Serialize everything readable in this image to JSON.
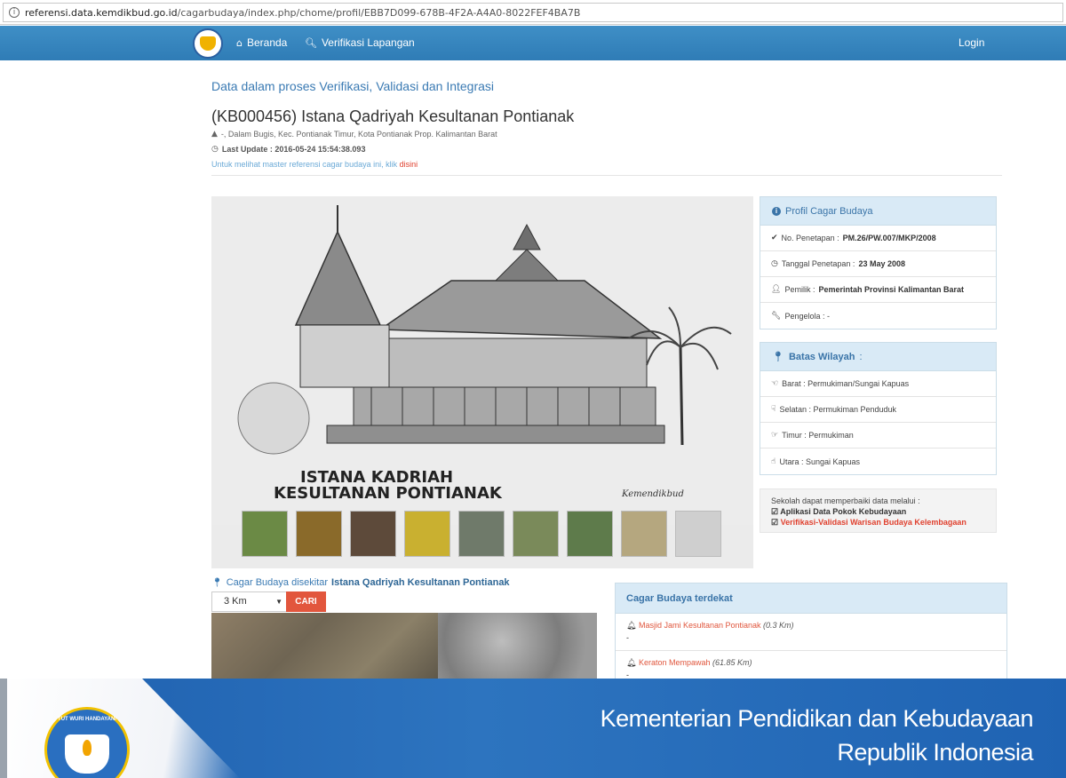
{
  "browser": {
    "url_host": "referensi.data.kemdikbud.go.id",
    "url_path": "/cagarbudaya/index.php/chome/profil/EBB7D099-678B-4F2A-A4A0-8022FEF4BA7B"
  },
  "navbar": {
    "home_label": "Beranda",
    "verif_label": "Verifikasi Lapangan",
    "login_label": "Login",
    "home_icon": "home-icon",
    "search_icon": "search-icon"
  },
  "header": {
    "status": "Data dalam proses Verifikasi, Validasi dan Integrasi",
    "title": "(KB000456) Istana Qadriyah Kesultanan Pontianak",
    "address": "-, Dalam Bugis, Kec. Pontianak Timur, Kota Pontianak Prop. Kalimantan Barat",
    "last_update_label": "Last Update : 2016-05-24 15:54:38.093",
    "master_text": "Untuk melihat master referensi cagar budaya ini, klik",
    "master_link": "disini"
  },
  "gallery": {
    "sketch_caption_1": "ISTANA KADRIAH",
    "sketch_caption_2": "KESULTANAN PONTIANAK",
    "sketch_signature": "Kemendikbud",
    "thumbnails": [
      {
        "color": "#6b8a45"
      },
      {
        "color": "#8a6a2a"
      },
      {
        "color": "#5d4a3a"
      },
      {
        "color": "#c9b030"
      },
      {
        "color": "#6f7a6a"
      },
      {
        "color": "#7a8a5a"
      },
      {
        "color": "#5e7b4b"
      },
      {
        "color": "#b5a77f"
      },
      {
        "color": "#cfcfcf"
      }
    ]
  },
  "profil": {
    "title": "Profil Cagar Budaya",
    "no_label": "No. Penetapan :",
    "no_value": "PM.26/PW.007/MKP/2008",
    "tgl_label": "Tanggal Penetapan :",
    "tgl_value": "23 May 2008",
    "pemilik_label": "Pemilik :",
    "pemilik_value": "Pemerintah Provinsi Kalimantan Barat",
    "pengelola": "Pengelola : -"
  },
  "batas": {
    "title": "Batas Wilayah",
    "title_suffix": ":",
    "barat": "Barat : Permukiman/Sungai Kapuas",
    "selatan": "Selatan : Permukiman Penduduk",
    "timur": "Timur : Permukiman",
    "utara": "Utara : Sungai Kapuas"
  },
  "sekolah": {
    "intro": "Sekolah dapat memperbaiki data melalui :",
    "link1": "Aplikasi Data Pokok Kebudayaan",
    "link2": "Verifikasi-Validasi Warisan Budaya Kelembagaan"
  },
  "nearby": {
    "title_prefix": "Cagar Budaya disekitar",
    "title_name": "Istana Qadriyah Kesultanan Pontianak",
    "km_value": "3 Km",
    "cari_label": "CARI"
  },
  "terdekat": {
    "title": "Cagar Budaya terdekat",
    "items": [
      {
        "name": "Masjid Jami Kesultanan Pontianak",
        "dist": "(0.3 Km)",
        "sub": "-"
      },
      {
        "name": "Keraton Mempawah",
        "dist": "(61.85 Km)",
        "sub": "-"
      }
    ]
  },
  "banner": {
    "line1": "Kementerian Pendidikan dan Kebudayaan",
    "line2": "Republik Indonesia",
    "emblem_text": "TUT WURI HANDAYANI"
  }
}
